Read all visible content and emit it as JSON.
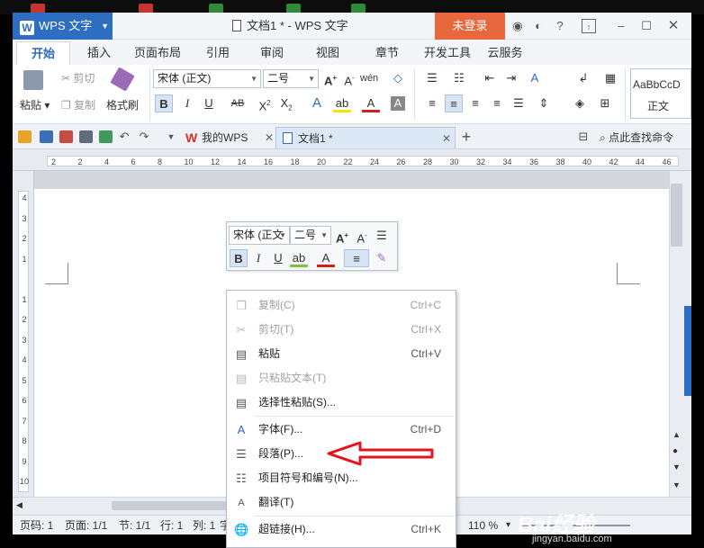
{
  "app": {
    "name": "WPS 文字",
    "window_title": "文档1 * - WPS 文字",
    "login_label": "未登录"
  },
  "ribbon_tabs": [
    "开始",
    "插入",
    "页面布局",
    "引用",
    "审阅",
    "视图",
    "章节",
    "开发工具",
    "云服务"
  ],
  "ribbon": {
    "paste_label": "粘贴",
    "cut_label": "剪切",
    "copy_label": "复制",
    "format_painter_label": "格式刷",
    "font_name": "宋体 (正文)",
    "font_size": "二号",
    "style_preview": "AaBbCcD",
    "style_name": "正文"
  },
  "doc_tabs": {
    "wps_tab": "我的WPS",
    "doc_tab": "文档1 *",
    "command_search": "点此查找命令"
  },
  "ruler": {
    "h_labels": [
      "2",
      "2",
      "4",
      "6",
      "8",
      "10",
      "12",
      "14",
      "16",
      "18",
      "20",
      "22",
      "24",
      "26",
      "28",
      "30",
      "32",
      "34",
      "36",
      "38",
      "40",
      "42",
      "44",
      "46"
    ],
    "v_labels": [
      "4",
      "3",
      "2",
      "1",
      "",
      "1",
      "2",
      "3",
      "4",
      "5",
      "6",
      "7",
      "8",
      "9",
      "10"
    ]
  },
  "mini_toolbar": {
    "font_name": "宋体 (正文",
    "font_size": "二号"
  },
  "context_menu": [
    {
      "icon": "copy-icon",
      "label": "复制(C)",
      "shortcut": "Ctrl+C",
      "disabled": true
    },
    {
      "icon": "cut-icon",
      "label": "剪切(T)",
      "shortcut": "Ctrl+X",
      "disabled": true
    },
    {
      "icon": "paste-icon",
      "label": "粘贴",
      "shortcut": "Ctrl+V",
      "disabled": false
    },
    {
      "icon": "paste-text-icon",
      "label": "只粘贴文本(T)",
      "shortcut": "",
      "disabled": true
    },
    {
      "icon": "paste-special-icon",
      "label": "选择性粘贴(S)...",
      "shortcut": "",
      "disabled": false
    },
    {
      "icon": "font-icon",
      "label": "字体(F)...",
      "shortcut": "Ctrl+D",
      "disabled": false
    },
    {
      "icon": "paragraph-icon",
      "label": "段落(P)...",
      "shortcut": "",
      "disabled": false
    },
    {
      "icon": "bullets-numbering-icon",
      "label": "项目符号和编号(N)...",
      "shortcut": "",
      "disabled": false
    },
    {
      "icon": "translate-icon",
      "label": "翻译(T)",
      "shortcut": "",
      "disabled": false
    },
    {
      "icon": "hyperlink-icon",
      "label": "超链接(H)...",
      "shortcut": "Ctrl+K",
      "disabled": false
    }
  ],
  "status": {
    "page_number": "页码: 1",
    "pages": "页面: 1/1",
    "section": "节: 1/1",
    "row": "行: 1",
    "col": "列: 1",
    "trunc": "字",
    "zoom": "110 %"
  },
  "watermark": {
    "text": "Bai经验",
    "sub": "jingyan.baidu.com"
  },
  "colors": {
    "accent_blue": "#2e6ec2",
    "login_orange": "#e8673c",
    "annotation_red": "#e0161b"
  }
}
